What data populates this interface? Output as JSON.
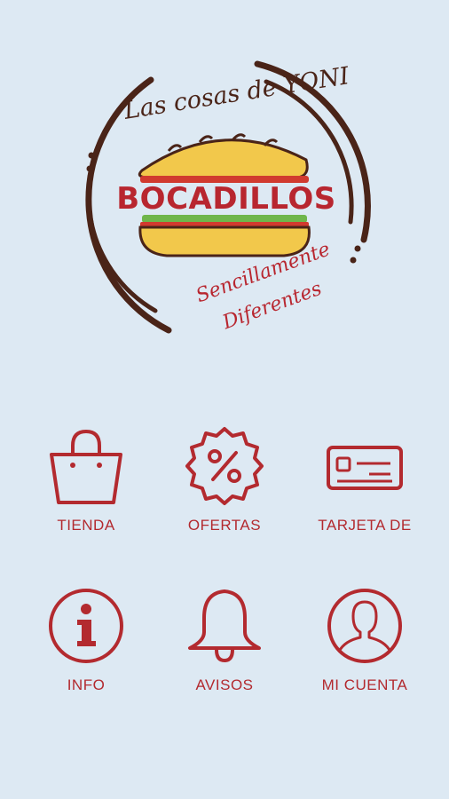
{
  "colors": {
    "background": "#dde9f3",
    "accent": "#b32a2f",
    "dark": "#4a2418",
    "bread": "#f2c84b"
  },
  "logo": {
    "brand_top": "Las cosas de YONI",
    "brand_main": "BOCADILLOS",
    "tagline_line1": "Sencillamente",
    "tagline_line2": "Diferentes"
  },
  "menu": {
    "items": [
      {
        "label": "TIENDA",
        "icon": "shopping-bag-icon"
      },
      {
        "label": "OFERTAS",
        "icon": "percent-badge-icon"
      },
      {
        "label": "TARJETA DE",
        "icon": "card-icon"
      },
      {
        "label": "INFO",
        "icon": "info-icon"
      },
      {
        "label": "AVISOS",
        "icon": "bell-icon"
      },
      {
        "label": "MI CUENTA",
        "icon": "user-icon"
      }
    ]
  }
}
